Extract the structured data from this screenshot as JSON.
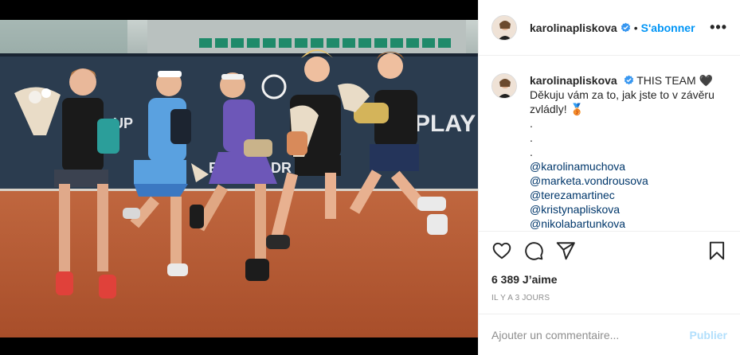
{
  "post": {
    "username": "karolinapliskova",
    "follow_label": "S'abonner",
    "separator": "•",
    "more_label": "•••",
    "caption": {
      "username": "karolinapliskova",
      "line1": "THIS TEAM 🖤",
      "line2": "Děkuju vám za to, jak jste to v závěru zvládly! 🥉",
      "dots": [
        ".",
        ".",
        "."
      ],
      "mentions": [
        "@karolinamuchova",
        "@marketa.vondrousova",
        "@terezamartinec",
        "@kristynapliskova",
        "@nikolabartunkova"
      ],
      "trailing": "."
    },
    "likes": "6 389 J’aime",
    "time_ago": "IL Y A 3 JOURS",
    "comment_placeholder": "Ajouter un commentaire...",
    "publish_label": "Publier",
    "photo_banner_text": "PLAY",
    "photo_banner_text2": "EN",
    "photo_banner_text3": "DR",
    "photo_banner_text4": "UP"
  },
  "colors": {
    "accent": "#0095f6",
    "publish_disabled": "#b2dffc",
    "clay": "#b5532f",
    "banner": "#2a3d52"
  },
  "icons": {
    "heart": "heart-icon",
    "comment": "comment-icon",
    "share": "paper-plane-icon",
    "save": "bookmark-icon",
    "verified": "verified-badge-icon"
  }
}
